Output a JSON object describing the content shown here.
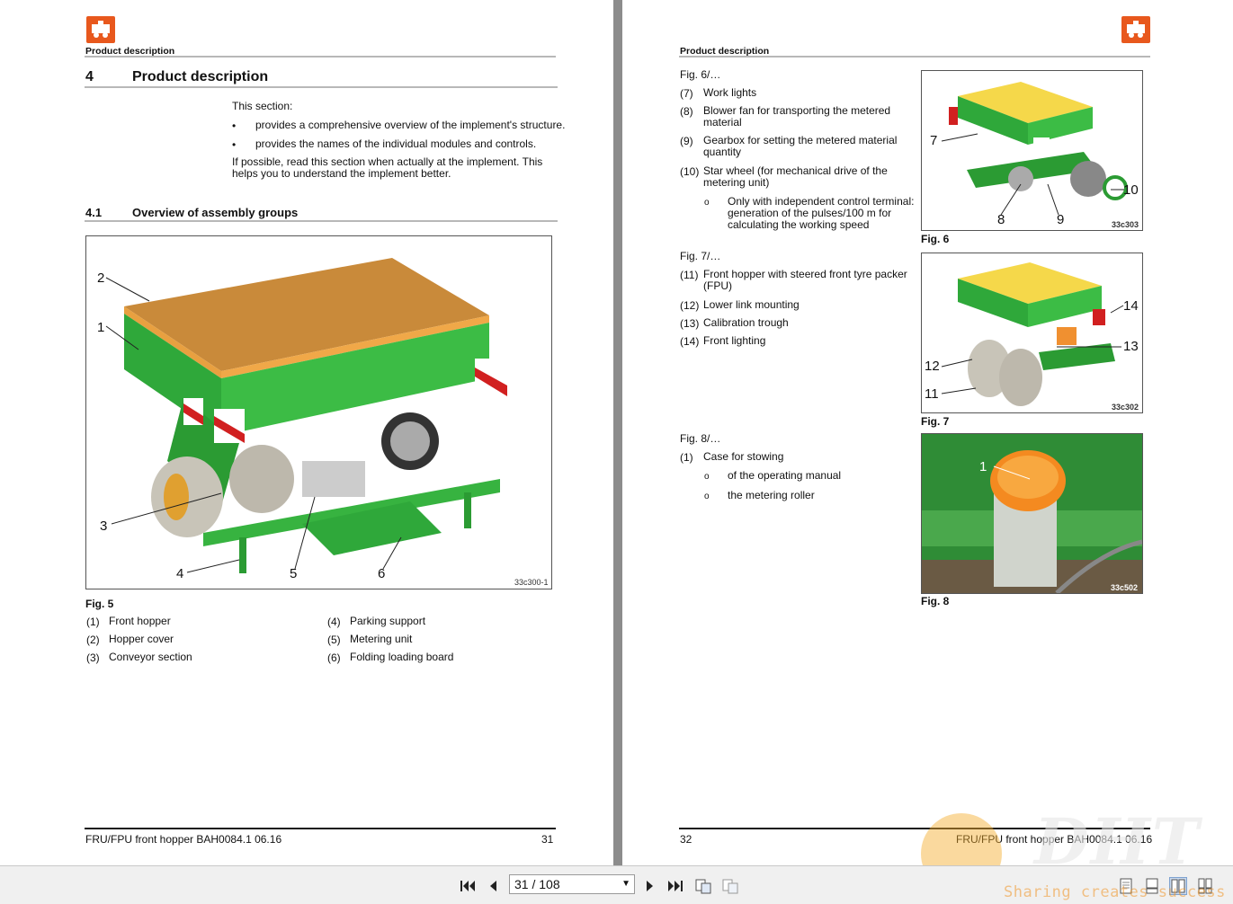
{
  "left_page": {
    "header": "Product description",
    "section_number": "4",
    "section_title": "Product description",
    "intro": "This section:",
    "bullets": [
      "provides a comprehensive overview of the implement's structure.",
      "provides the names of the individual modules and controls."
    ],
    "note_line1": "If possible, read this section when actually at the implement. This",
    "note_line2": "helps you to understand the implement better.",
    "subsection_number": "4.1",
    "subsection_title": "Overview of assembly groups",
    "figure": {
      "code": "33c300-1",
      "caption": "Fig. 5",
      "callouts": [
        "2",
        "1",
        "3",
        "4",
        "5",
        "6"
      ]
    },
    "legend_col1": [
      {
        "num": "(1)",
        "label": "Front hopper"
      },
      {
        "num": "(2)",
        "label": "Hopper cover"
      },
      {
        "num": "(3)",
        "label": "Conveyor section"
      }
    ],
    "legend_col2": [
      {
        "num": "(4)",
        "label": "Parking support"
      },
      {
        "num": "(5)",
        "label": "Metering unit"
      },
      {
        "num": "(6)",
        "label": "Folding loading board"
      }
    ],
    "footer_title": "FRU/FPU front hopper  BAH0084.1  06.16",
    "page_number": "31"
  },
  "right_page": {
    "header": "Product description",
    "fig6_ref": "Fig. 6/…",
    "fig6_items": [
      {
        "num": "(7)",
        "l1": "Work lights",
        "l2": ""
      },
      {
        "num": "(8)",
        "l1": "Blower fan for transporting the metered",
        "l2": "material"
      },
      {
        "num": "(9)",
        "l1": "Gearbox for setting the metered material",
        "l2": "quantity"
      },
      {
        "num": "(10)",
        "l1": "Star wheel (for mechanical drive of the",
        "l2": "metering unit)"
      }
    ],
    "fig6_sub": [
      "Only with independent control terminal:",
      "generation of the pulses/100 m for",
      "calculating the working speed"
    ],
    "fig7_ref": "Fig. 7/…",
    "fig7_items": [
      {
        "num": "(11)",
        "l1": "Front hopper with steered front tyre packer",
        "l2": "(FPU)"
      },
      {
        "num": "(12)",
        "l1": "Lower link mounting",
        "l2": ""
      },
      {
        "num": "(13)",
        "l1": "Calibration trough",
        "l2": ""
      },
      {
        "num": "(14)",
        "l1": "Front lighting",
        "l2": ""
      }
    ],
    "fig8_ref": "Fig. 8/…",
    "fig8_item": {
      "num": "(1)",
      "label": "Case for stowing"
    },
    "fig8_sub": [
      "of the operating manual",
      "the metering roller"
    ],
    "figures": [
      {
        "caption": "Fig. 6",
        "code": "33c303",
        "callouts": [
          "7",
          "8",
          "9",
          "10"
        ]
      },
      {
        "caption": "Fig. 7",
        "code": "33c302",
        "callouts": [
          "14",
          "13",
          "12",
          "11"
        ]
      },
      {
        "caption": "Fig. 8",
        "code": "33c502",
        "callouts": [
          "1"
        ]
      }
    ],
    "page_number": "32",
    "footer_title": "FRU/FPU front hopper  BAH0084.1  06.16"
  },
  "toolbar": {
    "page_indicator": "31 / 108",
    "icons": [
      "first-page-icon",
      "prev-page-icon",
      "next-page-icon",
      "last-page-icon",
      "rotate-view-icon",
      "copy-view-icon",
      "single-page-icon",
      "continuous-icon",
      "two-page-icon",
      "two-page-continuous-icon"
    ]
  },
  "watermark": {
    "big": "DHT",
    "tagline": "Sharing creates success"
  },
  "colors": {
    "brand_orange": "#e8581d",
    "machine_green": "#2fa83a",
    "hopper_cover": "#c98a3a"
  }
}
